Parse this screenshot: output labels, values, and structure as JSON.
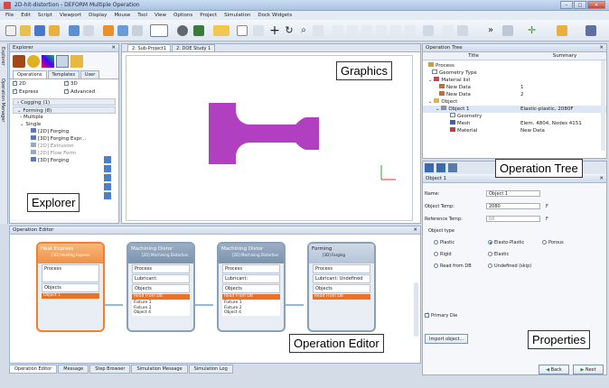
{
  "window": {
    "title": "2D-hit-distortion - DEFORM Multiple Operation"
  },
  "menu": [
    "File",
    "Edit",
    "Script",
    "Viewport",
    "Display",
    "Mouse",
    "Tool",
    "View",
    "Options",
    "Project",
    "Simulation",
    "Dock Widgets"
  ],
  "explorer": {
    "title": "Explorer",
    "side_tabs": [
      "Explorer",
      "Operation Manager"
    ],
    "tabs": [
      "Operations",
      "Templates",
      "User"
    ],
    "checks": [
      {
        "label": "2D",
        "checked": true
      },
      {
        "label": "3D",
        "checked": true
      },
      {
        "label": "Express",
        "checked": true
      },
      {
        "label": "Advanced",
        "checked": true
      }
    ],
    "groups": [
      "Cogging (1)",
      "Forming (8)"
    ],
    "tree": [
      "Multiple",
      "Single",
      "[2D] Forging",
      "[3D] Forging Expr...",
      "[2D] Extrusion",
      "[2D] Flow Form",
      "[3D] Forging"
    ]
  },
  "graphics": {
    "tabs": [
      "2: Sub-Project1",
      "2: DOE Study 1"
    ]
  },
  "operation_tree": {
    "title": "Operation Tree",
    "columns": [
      "Title",
      "Summary"
    ],
    "rows": [
      {
        "title": "Process",
        "summary": ""
      },
      {
        "title": "Geometry Type",
        "summary": ""
      },
      {
        "title": "Material list",
        "summary": ""
      },
      {
        "title": "New Data",
        "summary": "1"
      },
      {
        "title": "New Data",
        "summary": "2"
      },
      {
        "title": "Object",
        "summary": ""
      },
      {
        "title": "Object 1",
        "summary": "Elastic-plastic, 2080F"
      },
      {
        "title": "Geometry",
        "summary": ""
      },
      {
        "title": "Mesh",
        "summary": "Elem. 4804, Nodes 4151"
      },
      {
        "title": "Material",
        "summary": "New Data"
      }
    ]
  },
  "properties": {
    "header": "Object 1",
    "name_label": "Name:",
    "name_value": "Object 1",
    "temp_label": "Object Temp:",
    "temp_value": "2080",
    "temp_unit": "F",
    "ref_label": "Reference Temp:",
    "ref_value": "68",
    "ref_unit": "F",
    "type_label": "Object type",
    "types": [
      {
        "label": "Plastic",
        "selected": false
      },
      {
        "label": "Elasto-Plastic",
        "selected": true
      },
      {
        "label": "Porous",
        "selected": false
      },
      {
        "label": "Rigid",
        "selected": false
      },
      {
        "label": "Elastic",
        "selected": false
      },
      {
        "label": "Read from DB",
        "selected": false
      },
      {
        "label": "Undefined (skip)",
        "selected": false
      }
    ],
    "primary_die": "Primary Die",
    "import_btn": "Import object...",
    "back": "Back",
    "next": "Next"
  },
  "op_editor": {
    "title": "Operation Editor",
    "nodes": [
      {
        "title": "Heat Express",
        "sub": "[3D] Heating Express",
        "process": "Process",
        "lubricant": "",
        "objects": "Objects",
        "bar": "Object 1",
        "items": []
      },
      {
        "title": "Machining Distor",
        "sub": "[2D] Machining Distortion",
        "process": "Process",
        "lubricant": "Lubricant:",
        "objects": "Objects",
        "bar": "Read From DB",
        "items": [
          "Fixture 1",
          "Fixture 2",
          "Object 4"
        ]
      },
      {
        "title": "Machining Distor",
        "sub": "[2D] Machining Distortion",
        "process": "Process",
        "lubricant": "Lubricant:",
        "objects": "Objects",
        "bar": "Read From DB",
        "items": [
          "Fixture 1",
          "Fixture 2",
          "Object 4"
        ]
      },
      {
        "title": "Forming",
        "sub": "[3D] Forging",
        "process": "Process",
        "lubricant": "Lubricant: Undefined",
        "objects": "Objects",
        "bar": "Read From DB",
        "items": []
      }
    ],
    "bottom_tabs": [
      "Operation Editor",
      "Message",
      "Step Browser",
      "Simulation Message",
      "Simulation Log"
    ]
  },
  "callouts": {
    "graphics": "Graphics",
    "explorer": "Explorer",
    "operation_tree": "Operation Tree",
    "operation_editor": "Operation Editor",
    "properties": "Properties"
  },
  "colors": {
    "accent_orange": "#f07020",
    "part_purple": "#b040c0",
    "title_blue": "#a9c3e3"
  }
}
